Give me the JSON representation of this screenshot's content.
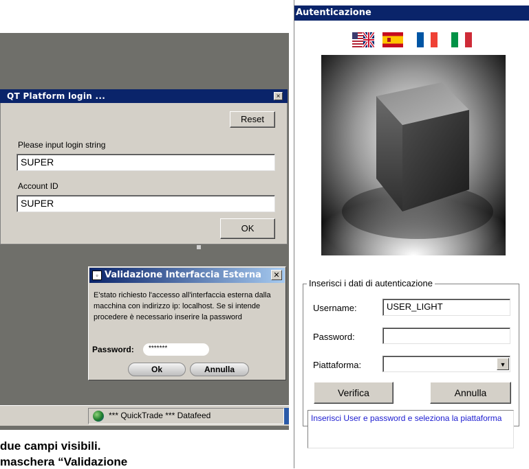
{
  "qt_login": {
    "title": "QT Platform login ...",
    "reset_label": "Reset",
    "login_prompt": "Please input login string",
    "login_value": "SUPER",
    "account_label": "Account ID",
    "account_value": "SUPER",
    "ok_label": "OK"
  },
  "validazione": {
    "title": "Validazione Interfaccia Esterna",
    "message": "E'stato richiesto l'accesso all'interfaccia esterna dalla macchina con indirizzo ip: localhost. Se si intende procedere è necessario inserire la password",
    "password_label": "Password:",
    "password_value": "*******",
    "ok_label": "Ok",
    "cancel_label": "Annulla"
  },
  "taskbar": {
    "tray_text": "*** QuickTrade *** Datafeed"
  },
  "caption": {
    "line1": "due campi visibili.",
    "line2": "maschera “Validazione"
  },
  "auth": {
    "title": "Autenticazione",
    "flags": [
      "english-flag",
      "spanish-flag",
      "french-flag",
      "italian-flag"
    ],
    "group_label": "Inserisci i dati di autenticazione",
    "username_label": "Username:",
    "username_value": "USER_LIGHT",
    "password_label": "Password:",
    "password_value": "",
    "platform_label": "Piattaforma:",
    "platform_value": "",
    "verify_label": "Verifica",
    "cancel_label": "Annulla",
    "status_text": "Inserisci User e password e seleziona la piattaforma"
  },
  "colors": {
    "title_bar": "#0a246a",
    "dialog_face": "#d4d0c8",
    "status_text": "#1b1bd0",
    "desktop": "#6f6f6a"
  }
}
